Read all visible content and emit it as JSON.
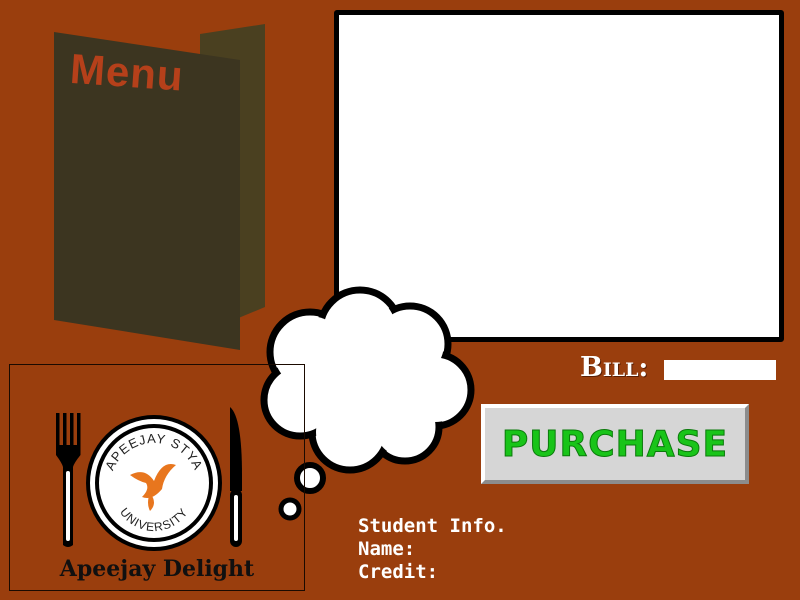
{
  "menu": {
    "title": "Menu"
  },
  "bill": {
    "label": "Bill:",
    "value": ""
  },
  "purchase": {
    "label": "PURCHASE"
  },
  "student": {
    "heading": "Student Info.",
    "name_label": "Name:",
    "credit_label": "Credit:"
  },
  "logo": {
    "brand_name": "Apeejay Delight",
    "university_top": "APEEJAY STYA",
    "university_bottom": "UNIVERSITY",
    "icons": [
      "fork-icon",
      "plate-logo",
      "knife-icon",
      "bird-emblem-icon"
    ]
  },
  "colors": {
    "background": "#9a3e0d",
    "menu_cover": "#3c3520",
    "menu_title": "#b5401a",
    "purchase_text": "#19c419",
    "display_board": "#ffffff"
  }
}
